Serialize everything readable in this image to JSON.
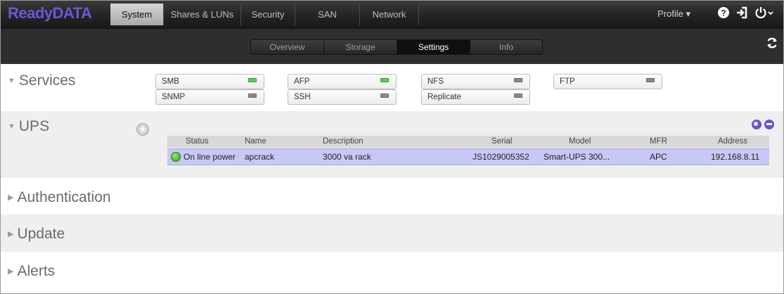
{
  "app": {
    "logo": "ReadyDATA"
  },
  "nav": {
    "tabs": [
      "System",
      "Shares & LUNs",
      "Security",
      "SAN",
      "Network"
    ],
    "active_tab": "System",
    "profile_label": "Profile ▾",
    "icons": [
      "help-icon",
      "logout-icon",
      "power-icon"
    ]
  },
  "subnav": {
    "tabs": [
      "Overview",
      "Storage",
      "Settings",
      "Info"
    ],
    "active_tab": "Settings",
    "refresh_icon": "refresh-icon"
  },
  "sections": {
    "services": {
      "title": "Services",
      "items": [
        {
          "label": "SMB",
          "status": "on"
        },
        {
          "label": "AFP",
          "status": "on"
        },
        {
          "label": "NFS",
          "status": "off"
        },
        {
          "label": "FTP",
          "status": "off"
        },
        {
          "label": "SNMP",
          "status": "off"
        },
        {
          "label": "SSH",
          "status": "off"
        },
        {
          "label": "Replicate",
          "status": "off"
        }
      ]
    },
    "ups": {
      "title": "UPS",
      "columns": [
        "Status",
        "Name",
        "Description",
        "Serial",
        "Model",
        "MFR",
        "Address"
      ],
      "rows": [
        {
          "status": "On line power",
          "name": "apcrack",
          "description": "3000 va rack",
          "serial": "JS1029005352",
          "model": "Smart-UPS 300...",
          "mfr": "APC",
          "address": "192.168.8.11"
        }
      ]
    },
    "authentication": {
      "title": "Authentication"
    },
    "update": {
      "title": "Update"
    },
    "alerts": {
      "title": "Alerts"
    }
  },
  "colors": {
    "accent": "#6a4fd9",
    "service_on": "#55d155",
    "service_off": "#8a8a8a",
    "ups_row_highlight": "#c8c8f6",
    "section_alt_bg": "#efefef"
  }
}
